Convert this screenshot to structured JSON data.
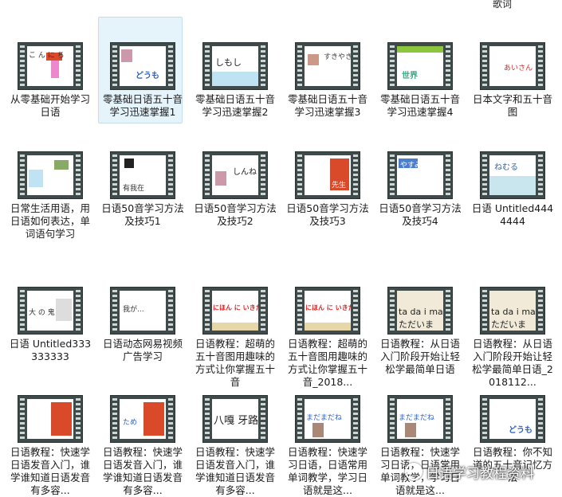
{
  "top_label": "歌词",
  "tiles": [
    {
      "caption": "从零基础开始学习日语",
      "row": 0,
      "col": 0,
      "thumb": "thumb-a",
      "selected": false
    },
    {
      "caption": "零基础日语五十音学习迅速掌握1",
      "row": 0,
      "col": 1,
      "thumb": "thumb-b",
      "selected": true
    },
    {
      "caption": "零基础日语五十音学习迅速掌握2",
      "row": 0,
      "col": 2,
      "thumb": "thumb-c",
      "selected": false
    },
    {
      "caption": "零基础日语五十音学习迅速掌握3",
      "row": 0,
      "col": 3,
      "thumb": "thumb-d",
      "selected": false
    },
    {
      "caption": "零基础日语五十音学习迅速掌握4",
      "row": 0,
      "col": 4,
      "thumb": "thumb-e",
      "selected": false
    },
    {
      "caption": "日本文字和五十音图",
      "row": 0,
      "col": 5,
      "thumb": "thumb-f",
      "selected": false
    },
    {
      "caption": "日常生活用语，用日语如何表达，单词语句学习",
      "row": 1,
      "col": 0,
      "thumb": "thumb-g",
      "selected": false
    },
    {
      "caption": "日语50音学习方法及技巧1",
      "row": 1,
      "col": 1,
      "thumb": "thumb-h",
      "selected": false
    },
    {
      "caption": "日语50音学习方法及技巧2",
      "row": 1,
      "col": 2,
      "thumb": "thumb-i",
      "selected": false
    },
    {
      "caption": "日语50音学习方法及技巧3",
      "row": 1,
      "col": 3,
      "thumb": "thumb-j",
      "selected": false
    },
    {
      "caption": "日语50音学习方法及技巧4",
      "row": 1,
      "col": 4,
      "thumb": "thumb-k",
      "selected": false
    },
    {
      "caption": "日语 Untitled4444444",
      "row": 1,
      "col": 5,
      "thumb": "thumb-l",
      "selected": false
    },
    {
      "caption": "日语 Untitled333333333",
      "row": 2,
      "col": 0,
      "thumb": "thumb-m",
      "selected": false
    },
    {
      "caption": "日语动态网易视频广告学习",
      "row": 2,
      "col": 1,
      "thumb": "thumb-n",
      "selected": false
    },
    {
      "caption": "日语教程：超萌的五十音图用趣味的方式让你掌握五十音",
      "row": 2,
      "col": 2,
      "thumb": "thumb-o",
      "selected": false
    },
    {
      "caption": "日语教程：超萌的五十音图用趣味的方式让你掌握五十音_2018...",
      "row": 2,
      "col": 3,
      "thumb": "thumb-o",
      "selected": false
    },
    {
      "caption": "日语教程：从日语入门阶段开始让轻松学最简单日语",
      "row": 2,
      "col": 4,
      "thumb": "thumb-p",
      "selected": false
    },
    {
      "caption": "日语教程：从日语入门阶段开始让轻松学最简单日语_2018112...",
      "row": 2,
      "col": 5,
      "thumb": "thumb-p",
      "selected": false
    },
    {
      "caption": "日语教程：快速学日语发音入门，谁学谁知道日语发音有多容...",
      "row": 3,
      "col": 0,
      "thumb": "thumb-q",
      "selected": false
    },
    {
      "caption": "日语教程：快速学日语发音入门，谁学谁知道日语发音有多容...",
      "row": 3,
      "col": 1,
      "thumb": "thumb-r",
      "selected": false
    },
    {
      "caption": "日语教程：快速学日语发音入门，谁学谁知道日语发音有多容...",
      "row": 3,
      "col": 2,
      "thumb": "thumb-s",
      "selected": false
    },
    {
      "caption": "日语教程：快速学习日语，日语常用单词教学，学习日语就是这...",
      "row": 3,
      "col": 3,
      "thumb": "thumb-t",
      "selected": false
    },
    {
      "caption": "日语教程：快速学习日语，日语常用单词教学，学习日语就是这...",
      "row": 3,
      "col": 4,
      "thumb": "thumb-t",
      "selected": false
    },
    {
      "caption": "日语教程：你不知道的五十音记忆方法",
      "row": 3,
      "col": 5,
      "thumb": "thumb-u",
      "selected": false
    }
  ],
  "thumb_text": {
    "b": "どうも",
    "c": "しもし",
    "d": "すきやき",
    "e": "世界",
    "f": "あいさん",
    "h": "有我在",
    "i": "しんね",
    "j": "先生",
    "k": "やすみ",
    "l": "ねむる",
    "n": "我が...",
    "o": "にほん に いきたい",
    "p1": "ta da i ma",
    "p2": "ただいま",
    "r": "ため",
    "s": "八嘎 牙路",
    "t": "まだまだね",
    "u": "どうも"
  },
  "watermark": "日语学习教程资料"
}
